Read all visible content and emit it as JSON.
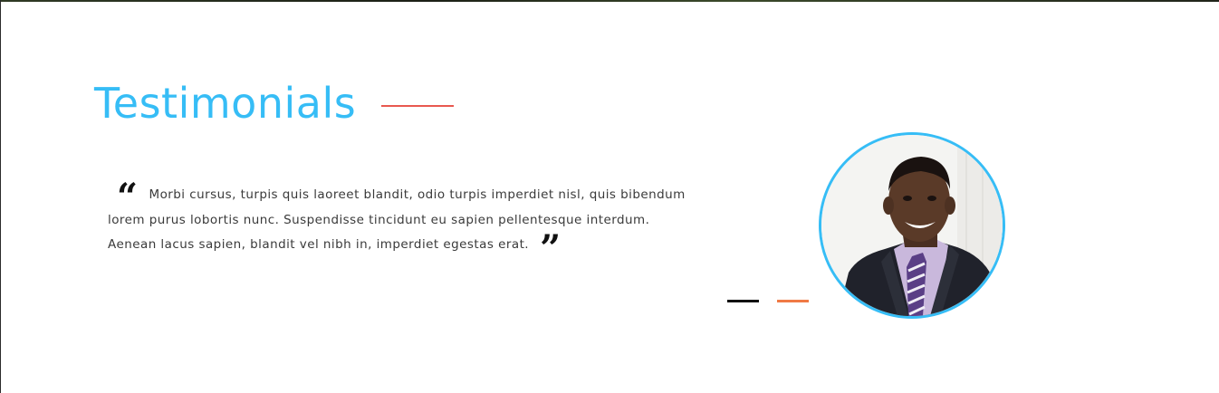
{
  "section": {
    "title": "Testimonials"
  },
  "testimonial": {
    "open_quote_glyph": "“",
    "text": "Morbi cursus, turpis quis laoreet blandit, odio turpis imperdiet nisl, quis bibendum lorem purus lobortis nunc. Suspendisse tincidunt eu sapien pellentesque interdum. Aenean lacus sapien, blandit vel nibh in, imperdiet egestas erat.",
    "close_quote_glyph": "”",
    "avatar_icon": "person-photo-icon"
  },
  "pager": {
    "count": 2,
    "active_index": 0
  },
  "colors": {
    "title": "#36bdf6",
    "accent_rule": "#e8584f",
    "avatar_border": "#36bdf6",
    "pager_active": "#111111",
    "pager_inactive": "#f07a45",
    "body_text": "#3a3a3a"
  }
}
